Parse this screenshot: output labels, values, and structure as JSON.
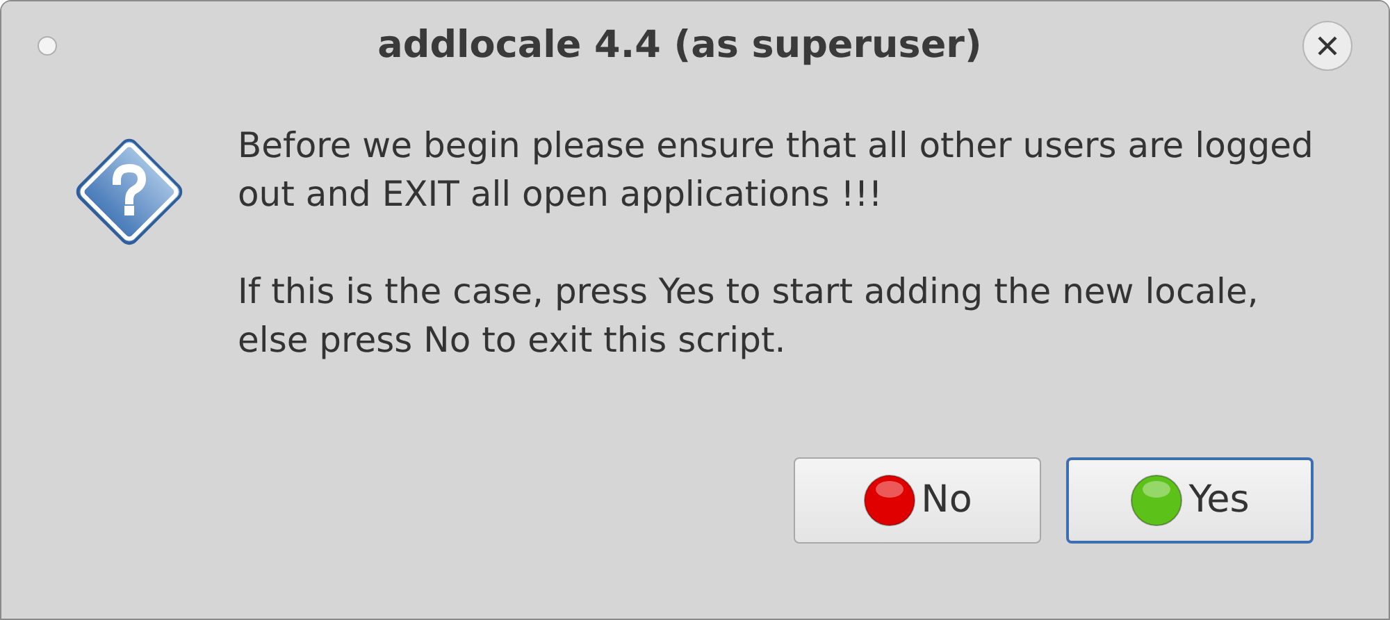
{
  "window": {
    "title": "addlocale 4.4 (as superuser)"
  },
  "message": [
    "Before we begin please ensure that all other users are logged out and EXIT all open applications !!!",
    "If this is the case, press Yes to start adding the new locale, else press No to exit this script."
  ],
  "buttons": [
    {
      "label": "No",
      "color": "#e00000",
      "focused": false
    },
    {
      "label": "Yes",
      "color": "#5cc21a",
      "focused": true
    }
  ]
}
